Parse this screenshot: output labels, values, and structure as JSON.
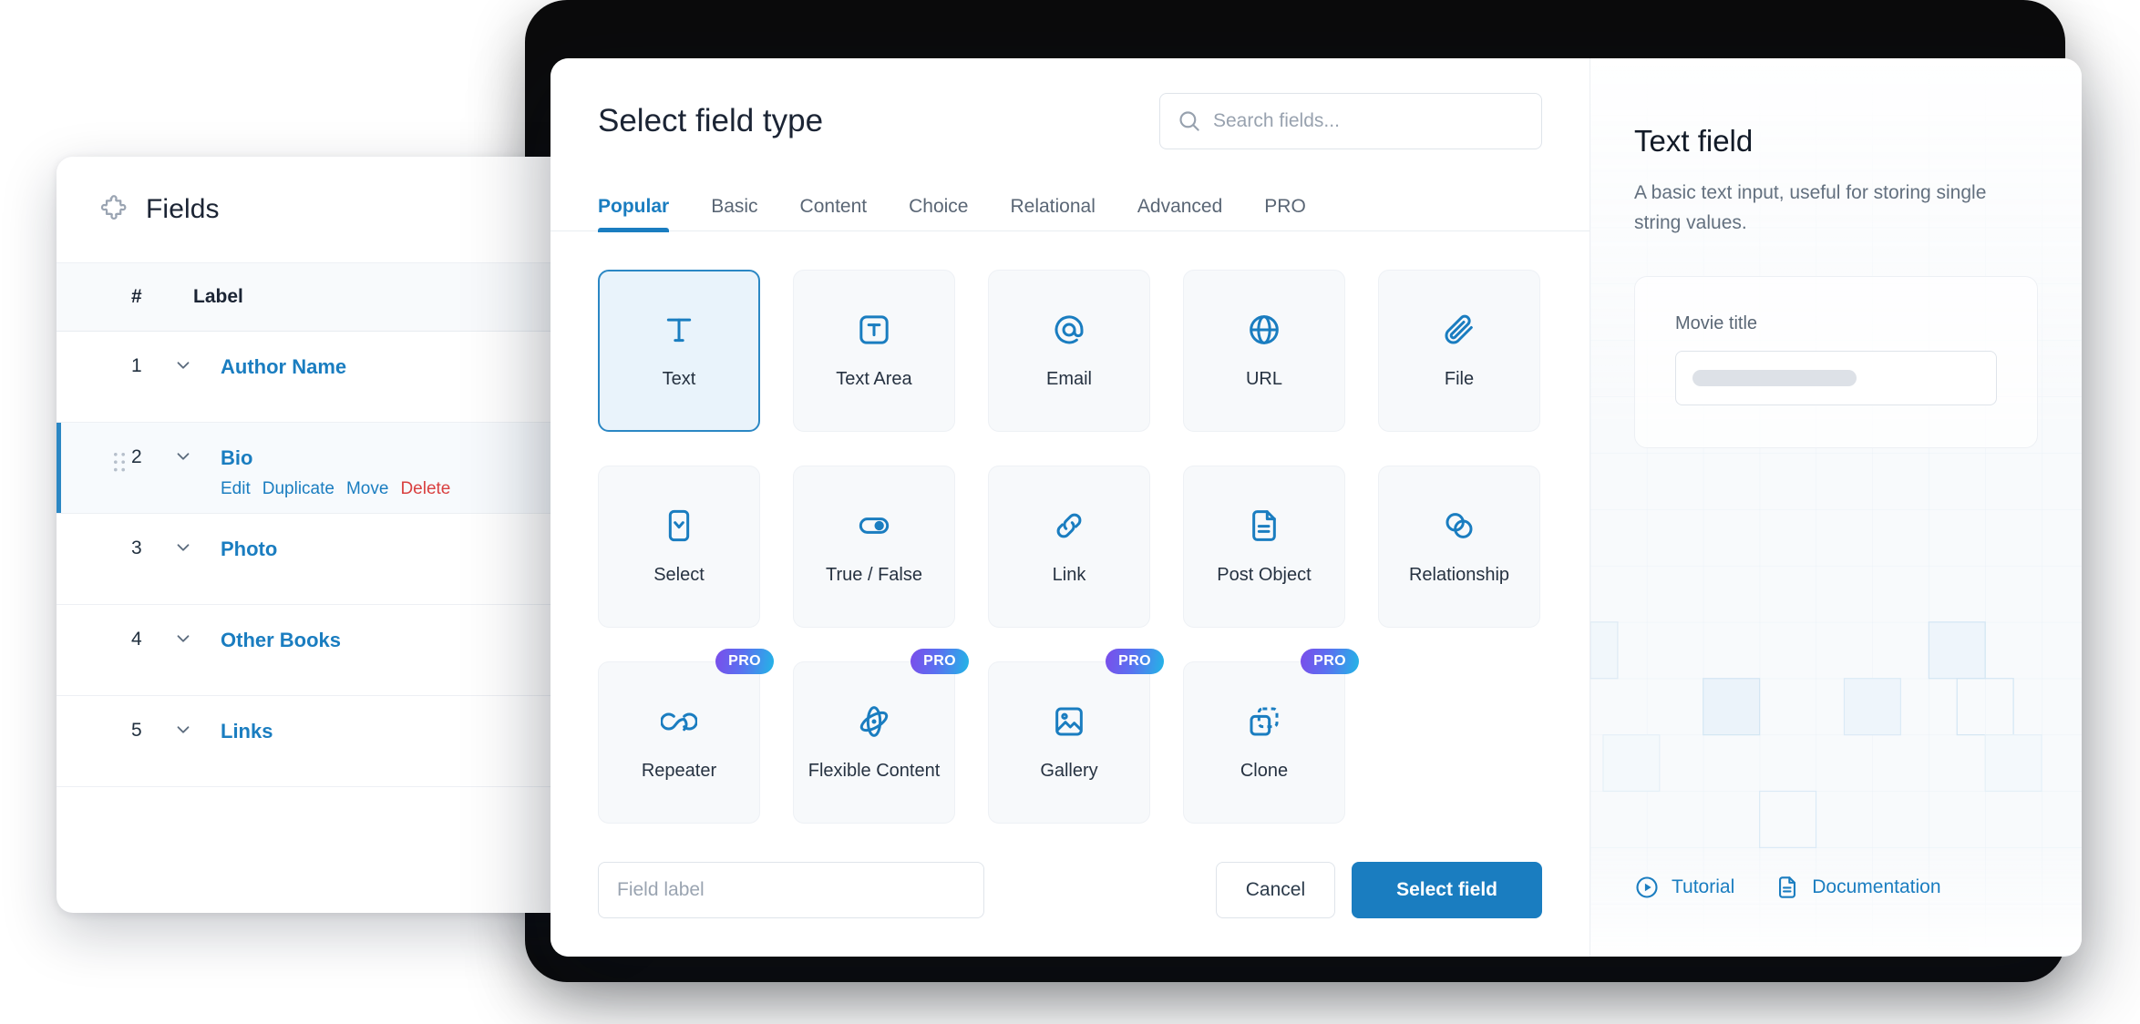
{
  "fields_panel": {
    "title": "Fields",
    "icon": "puzzle-icon",
    "columns": {
      "num": "#",
      "label": "Label"
    },
    "rows": [
      {
        "num": "1",
        "label": "Author Name",
        "active": false
      },
      {
        "num": "2",
        "label": "Bio",
        "active": true
      },
      {
        "num": "3",
        "label": "Photo",
        "active": false
      },
      {
        "num": "4",
        "label": "Other Books",
        "active": false
      },
      {
        "num": "5",
        "label": "Links",
        "active": false
      }
    ],
    "row_actions": {
      "edit": "Edit",
      "duplicate": "Duplicate",
      "move": "Move",
      "delete": "Delete"
    }
  },
  "modal": {
    "title": "Select field type",
    "search": {
      "placeholder": "Search fields...",
      "value": "",
      "icon": "search-icon"
    },
    "tabs": [
      {
        "label": "Popular",
        "active": true
      },
      {
        "label": "Basic",
        "active": false
      },
      {
        "label": "Content",
        "active": false
      },
      {
        "label": "Choice",
        "active": false
      },
      {
        "label": "Relational",
        "active": false
      },
      {
        "label": "Advanced",
        "active": false
      },
      {
        "label": "PRO",
        "active": false
      }
    ],
    "cards": [
      {
        "label": "Text",
        "icon": "text-icon",
        "selected": true,
        "pro": false
      },
      {
        "label": "Text Area",
        "icon": "text-area-icon",
        "selected": false,
        "pro": false
      },
      {
        "label": "Email",
        "icon": "email-icon",
        "selected": false,
        "pro": false
      },
      {
        "label": "URL",
        "icon": "globe-icon",
        "selected": false,
        "pro": false
      },
      {
        "label": "File",
        "icon": "paperclip-icon",
        "selected": false,
        "pro": false
      },
      {
        "label": "Select",
        "icon": "select-icon",
        "selected": false,
        "pro": false
      },
      {
        "label": "True / False",
        "icon": "toggle-icon",
        "selected": false,
        "pro": false
      },
      {
        "label": "Link",
        "icon": "link-icon",
        "selected": false,
        "pro": false
      },
      {
        "label": "Post Object",
        "icon": "document-icon",
        "selected": false,
        "pro": false
      },
      {
        "label": "Relationship",
        "icon": "relationship-icon",
        "selected": false,
        "pro": false
      },
      {
        "label": "Repeater",
        "icon": "infinity-icon",
        "selected": false,
        "pro": true
      },
      {
        "label": "Flexible Content",
        "icon": "atom-icon",
        "selected": false,
        "pro": true
      },
      {
        "label": "Gallery",
        "icon": "image-icon",
        "selected": false,
        "pro": true
      },
      {
        "label": "Clone",
        "icon": "clone-icon",
        "selected": false,
        "pro": true
      }
    ],
    "pro_badge_label": "PRO",
    "footer": {
      "field_label_placeholder": "Field label",
      "field_label_value": "",
      "cancel_label": "Cancel",
      "submit_label": "Select field"
    }
  },
  "sidebar": {
    "title": "Text field",
    "description": "A basic text input, useful for storing single string values.",
    "preview": {
      "label": "Movie title",
      "value": ""
    },
    "links": [
      {
        "label": "Tutorial",
        "icon": "play-circle-icon"
      },
      {
        "label": "Documentation",
        "icon": "document-icon"
      }
    ]
  },
  "colors": {
    "accent": "#1a7dc0",
    "selected_card_bg": "#e9f3fb",
    "selected_card_border": "#2b87c4",
    "danger": "#d94040",
    "pro_gradient_from": "#7b4dea",
    "pro_gradient_to": "#22b6e6",
    "panel_bg": "#f8fafc",
    "card_bg": "#f7f9fb"
  }
}
